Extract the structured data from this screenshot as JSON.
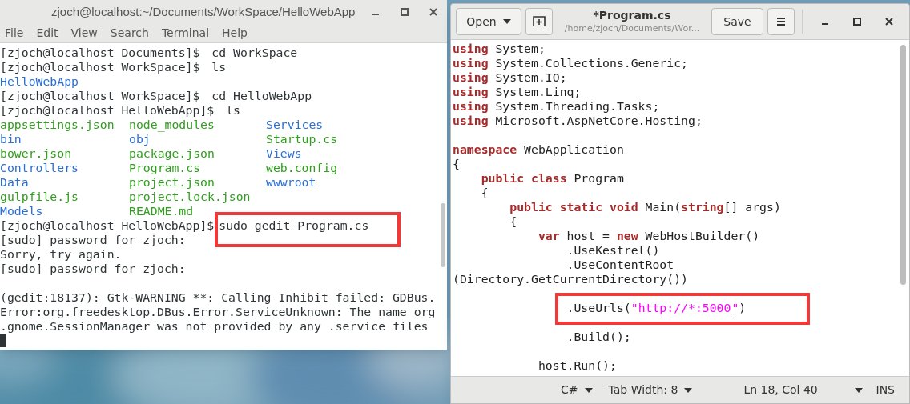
{
  "terminal": {
    "title": "zjoch@localhost:~/Documents/WorkSpace/HelloWebApp",
    "menu": [
      "File",
      "Edit",
      "View",
      "Search",
      "Terminal",
      "Help"
    ],
    "lines": [
      {
        "kind": "cmd",
        "prompt": "[zjoch@localhost Documents]$ ",
        "command": "cd WorkSpace",
        "highlighted": false
      },
      {
        "kind": "cmd",
        "prompt": "[zjoch@localhost WorkSpace]$ ",
        "command": "ls",
        "highlighted": false
      },
      {
        "kind": "ls",
        "items": [
          {
            "name": "HelloWebApp",
            "color": "#2a6fd6"
          }
        ]
      },
      {
        "kind": "cmd",
        "prompt": "[zjoch@localhost WorkSpace]$ ",
        "command": "cd HelloWebApp",
        "highlighted": false
      },
      {
        "kind": "cmd",
        "prompt": "[zjoch@localhost HelloWebApp]$ ",
        "command": "ls",
        "highlighted": false
      },
      {
        "kind": "ls",
        "items": [
          {
            "name": "appsettings.json",
            "color": "#2fa01c"
          },
          {
            "name": "node_modules",
            "color": "#2fa01c"
          },
          {
            "name": "Services",
            "color": "#2a6fd6"
          }
        ]
      },
      {
        "kind": "ls",
        "items": [
          {
            "name": "bin",
            "color": "#2a6fd6"
          },
          {
            "name": "obj",
            "color": "#2a6fd6"
          },
          {
            "name": "Startup.cs",
            "color": "#2fa01c"
          }
        ]
      },
      {
        "kind": "ls",
        "items": [
          {
            "name": "bower.json",
            "color": "#2fa01c"
          },
          {
            "name": "package.json",
            "color": "#2fa01c"
          },
          {
            "name": "Views",
            "color": "#2a6fd6"
          }
        ]
      },
      {
        "kind": "ls",
        "items": [
          {
            "name": "Controllers",
            "color": "#2a6fd6"
          },
          {
            "name": "Program.cs",
            "color": "#2fa01c"
          },
          {
            "name": "web.config",
            "color": "#2fa01c"
          }
        ]
      },
      {
        "kind": "ls",
        "items": [
          {
            "name": "Data",
            "color": "#2a6fd6"
          },
          {
            "name": "project.json",
            "color": "#2fa01c"
          },
          {
            "name": "wwwroot",
            "color": "#2a6fd6"
          }
        ]
      },
      {
        "kind": "ls",
        "items": [
          {
            "name": "gulpfile.js",
            "color": "#2fa01c"
          },
          {
            "name": "project.lock.json",
            "color": "#2fa01c"
          }
        ]
      },
      {
        "kind": "ls",
        "items": [
          {
            "name": "Models",
            "color": "#2a6fd6"
          },
          {
            "name": "README.md",
            "color": "#2fa01c"
          }
        ]
      },
      {
        "kind": "cmd",
        "prompt": "[zjoch@localhost HelloWebApp]$",
        "command": "sudo gedit Program.cs",
        "highlighted": true
      },
      {
        "kind": "text",
        "text": "[sudo] password for zjoch:"
      },
      {
        "kind": "text",
        "text": "Sorry, try again."
      },
      {
        "kind": "text",
        "text": "[sudo] password for zjoch:"
      },
      {
        "kind": "blank"
      },
      {
        "kind": "text",
        "text": "(gedit:18137): Gtk-WARNING **: Calling Inhibit failed: GDBus."
      },
      {
        "kind": "text",
        "text": "Error:org.freedesktop.DBus.Error.ServiceUnknown: The name org"
      },
      {
        "kind": "text",
        "text": ".gnome.SessionManager was not provided by any .service files"
      }
    ]
  },
  "editor": {
    "open_button": "Open",
    "title": "*Program.cs",
    "subtitle": "/home/zjoch/Documents/Wor...",
    "save_button": "Save",
    "code": [
      {
        "highlighted": false,
        "tokens": [
          {
            "kind": "keyword",
            "text": "using"
          },
          {
            "kind": "plain",
            "text": " System;"
          }
        ]
      },
      {
        "highlighted": false,
        "tokens": [
          {
            "kind": "keyword",
            "text": "using"
          },
          {
            "kind": "plain",
            "text": " System.Collections.Generic;"
          }
        ]
      },
      {
        "highlighted": false,
        "tokens": [
          {
            "kind": "keyword",
            "text": "using"
          },
          {
            "kind": "plain",
            "text": " System.IO;"
          }
        ]
      },
      {
        "highlighted": false,
        "tokens": [
          {
            "kind": "keyword",
            "text": "using"
          },
          {
            "kind": "plain",
            "text": " System.Linq;"
          }
        ]
      },
      {
        "highlighted": false,
        "tokens": [
          {
            "kind": "keyword",
            "text": "using"
          },
          {
            "kind": "plain",
            "text": " System.Threading.Tasks;"
          }
        ]
      },
      {
        "highlighted": false,
        "tokens": [
          {
            "kind": "keyword",
            "text": "using"
          },
          {
            "kind": "plain",
            "text": " Microsoft.AspNetCore.Hosting;"
          }
        ]
      },
      {
        "highlighted": false
      },
      {
        "highlighted": false,
        "tokens": [
          {
            "kind": "keyword",
            "text": "namespace"
          },
          {
            "kind": "plain",
            "text": " WebApplication"
          }
        ]
      },
      {
        "highlighted": false,
        "tokens": [
          {
            "kind": "plain",
            "text": "{"
          }
        ]
      },
      {
        "highlighted": false,
        "tokens": [
          {
            "kind": "keyword",
            "text": "    public class"
          },
          {
            "kind": "plain",
            "text": " Program"
          }
        ]
      },
      {
        "highlighted": false,
        "tokens": [
          {
            "kind": "plain",
            "text": "    {"
          }
        ]
      },
      {
        "highlighted": false,
        "tokens": [
          {
            "kind": "keyword",
            "text": "        public static void"
          },
          {
            "kind": "plain",
            "text": " Main("
          },
          {
            "kind": "keyword",
            "text": "string"
          },
          {
            "kind": "plain",
            "text": "[] args)"
          }
        ]
      },
      {
        "highlighted": false,
        "tokens": [
          {
            "kind": "plain",
            "text": "        {"
          }
        ]
      },
      {
        "highlighted": false,
        "tokens": [
          {
            "kind": "keyword",
            "text": "            var"
          },
          {
            "kind": "plain",
            "text": " host = "
          },
          {
            "kind": "keyword",
            "text": "new"
          },
          {
            "kind": "plain",
            "text": " WebHostBuilder()"
          }
        ]
      },
      {
        "highlighted": false,
        "tokens": [
          {
            "kind": "plain",
            "text": "                .UseKestrel()"
          }
        ]
      },
      {
        "highlighted": false,
        "tokens": [
          {
            "kind": "plain",
            "text": "                .UseContentRoot"
          }
        ]
      },
      {
        "highlighted": false,
        "tokens": [
          {
            "kind": "plain",
            "text": "(Directory.GetCurrentDirectory())"
          }
        ]
      },
      {
        "highlighted": false
      },
      {
        "highlighted": true,
        "tokens": [
          {
            "kind": "plain",
            "text": "                .UseUrls("
          },
          {
            "kind": "string",
            "text": "\"http://*:5000"
          },
          {
            "kind": "cursor"
          },
          {
            "kind": "string",
            "text": "\""
          },
          {
            "kind": "plain",
            "text": ")"
          }
        ]
      },
      {
        "highlighted": false
      },
      {
        "highlighted": false,
        "tokens": [
          {
            "kind": "plain",
            "text": "                .Build();"
          }
        ]
      },
      {
        "highlighted": false
      },
      {
        "highlighted": false,
        "tokens": [
          {
            "kind": "plain",
            "text": "            host.Run();"
          }
        ]
      }
    ],
    "status": {
      "language": "C#",
      "tab_width": "Tab Width: 8",
      "position": "Ln 18, Col 40",
      "mode": "INS"
    }
  }
}
